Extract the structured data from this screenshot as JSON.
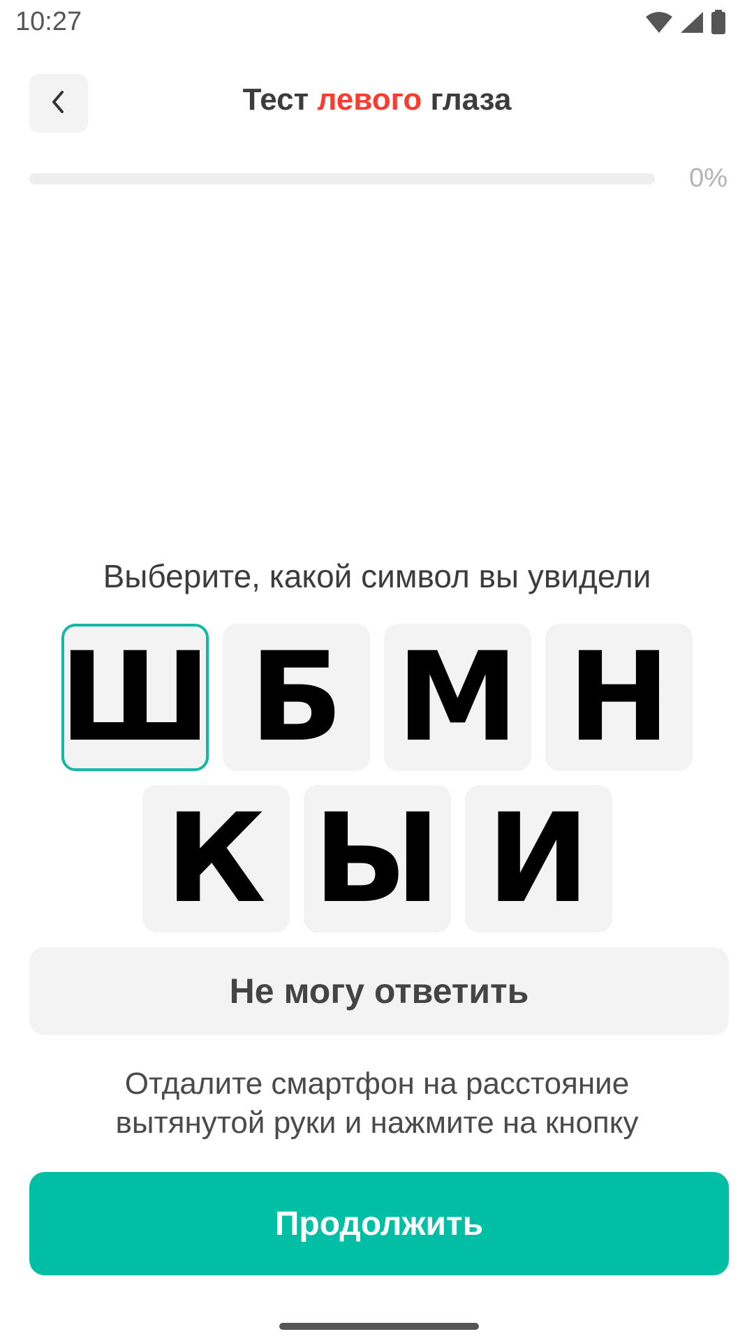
{
  "status_bar": {
    "time": "10:27",
    "icons": [
      "wifi-icon",
      "cellular-signal-icon",
      "battery-icon"
    ]
  },
  "header": {
    "back_icon": "chevron-left-icon",
    "title_prefix": "Тест",
    "title_accent": "левого",
    "title_suffix": "глаза",
    "accent_color": "#ff3b30"
  },
  "progress": {
    "value": 0,
    "label": "0%"
  },
  "prompt": "Выберите, какой символ вы увидели",
  "symbols": {
    "row1": [
      "Ш",
      "Б",
      "М",
      "Н"
    ],
    "row2": [
      "К",
      "Ы",
      "И"
    ],
    "selected": "Ш"
  },
  "cant_answer_label": "Не могу ответить",
  "hint": {
    "line1": "Отдалите смартфон на расстояние",
    "line2": "вытянутой руки и нажмите на кнопку"
  },
  "continue_label": "Продолжить",
  "colors": {
    "primary": "#00bfa5",
    "selected_border": "#12b8a6",
    "tile_bg": "#f3f3f3"
  }
}
